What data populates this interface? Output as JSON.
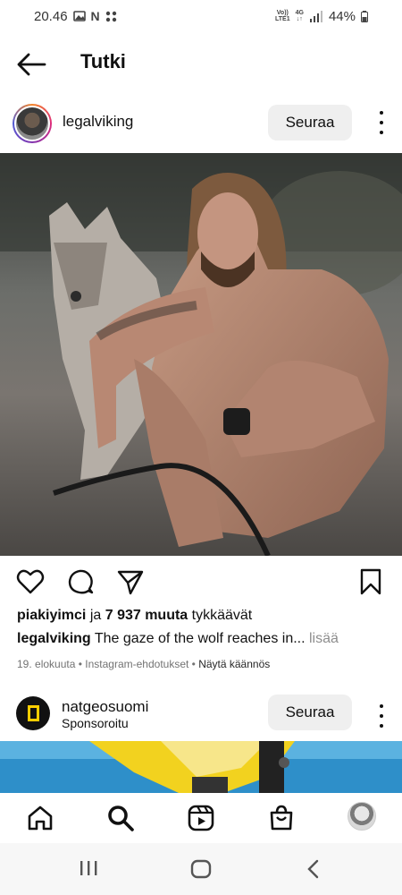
{
  "status_bar": {
    "time": "20.46",
    "notification_icons": [
      "image-icon",
      "n-icon",
      "dots-grid-icon"
    ],
    "volte_line1": "Vo))",
    "volte_line2": "LTE1",
    "network": "4G",
    "battery": "44%"
  },
  "header": {
    "title": "Tutki"
  },
  "post": {
    "username": "legalviking",
    "follow_label": "Seuraa",
    "likes_user": "piakiyimci",
    "likes_connector": " ja ",
    "likes_others": "7 937 muuta",
    "likes_suffix": " tykkäävät",
    "caption_user": "legalviking",
    "caption_text": "The gaze of the wolf reaches in...",
    "caption_more": " lisää",
    "date": "19. elokuuta",
    "suggestion": "Instagram-ehdotukset",
    "translate": "Näytä käännös",
    "separator": " • "
  },
  "sponsored": {
    "username": "natgeosuomi",
    "label": "Sponsoroitu",
    "follow_label": "Seuraa"
  },
  "bottom_nav": [
    "home-icon",
    "search-icon",
    "reels-icon",
    "shop-icon",
    "profile-avatar"
  ],
  "system_nav": [
    "recents-icon",
    "home-button-icon",
    "back-icon"
  ]
}
